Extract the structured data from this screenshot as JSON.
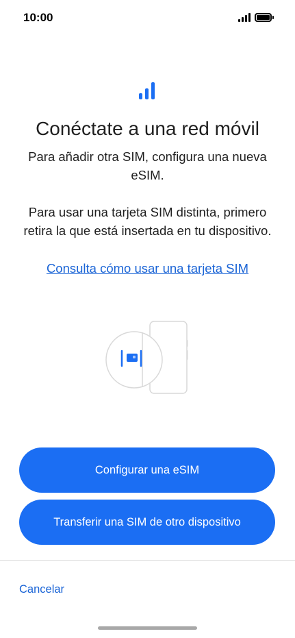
{
  "status_bar": {
    "time": "10:00",
    "signal_icon": "cellular-signal-icon",
    "battery_icon": "battery-full-icon"
  },
  "hero": {
    "icon": "signal-bars-icon",
    "title": "Conéctate a una red móvil",
    "subtitle": "Para añadir otra SIM, configura una nueva eSIM.",
    "body": "Para usar una tarjeta SIM distinta, primero retira la que está insertada en tu dispositivo.",
    "link": "Consulta cómo usar una tarjeta SIM"
  },
  "illustration": {
    "name": "phone-sim-slot-illustration"
  },
  "actions": {
    "configure_esim": "Configurar una eSIM",
    "transfer_sim": "Transferir una SIM de otro dispositivo",
    "cancel": "Cancelar"
  },
  "colors": {
    "accent": "#1b6ef3",
    "link": "#1a64d6",
    "text": "#1f1f1f",
    "background": "#ffffff"
  }
}
